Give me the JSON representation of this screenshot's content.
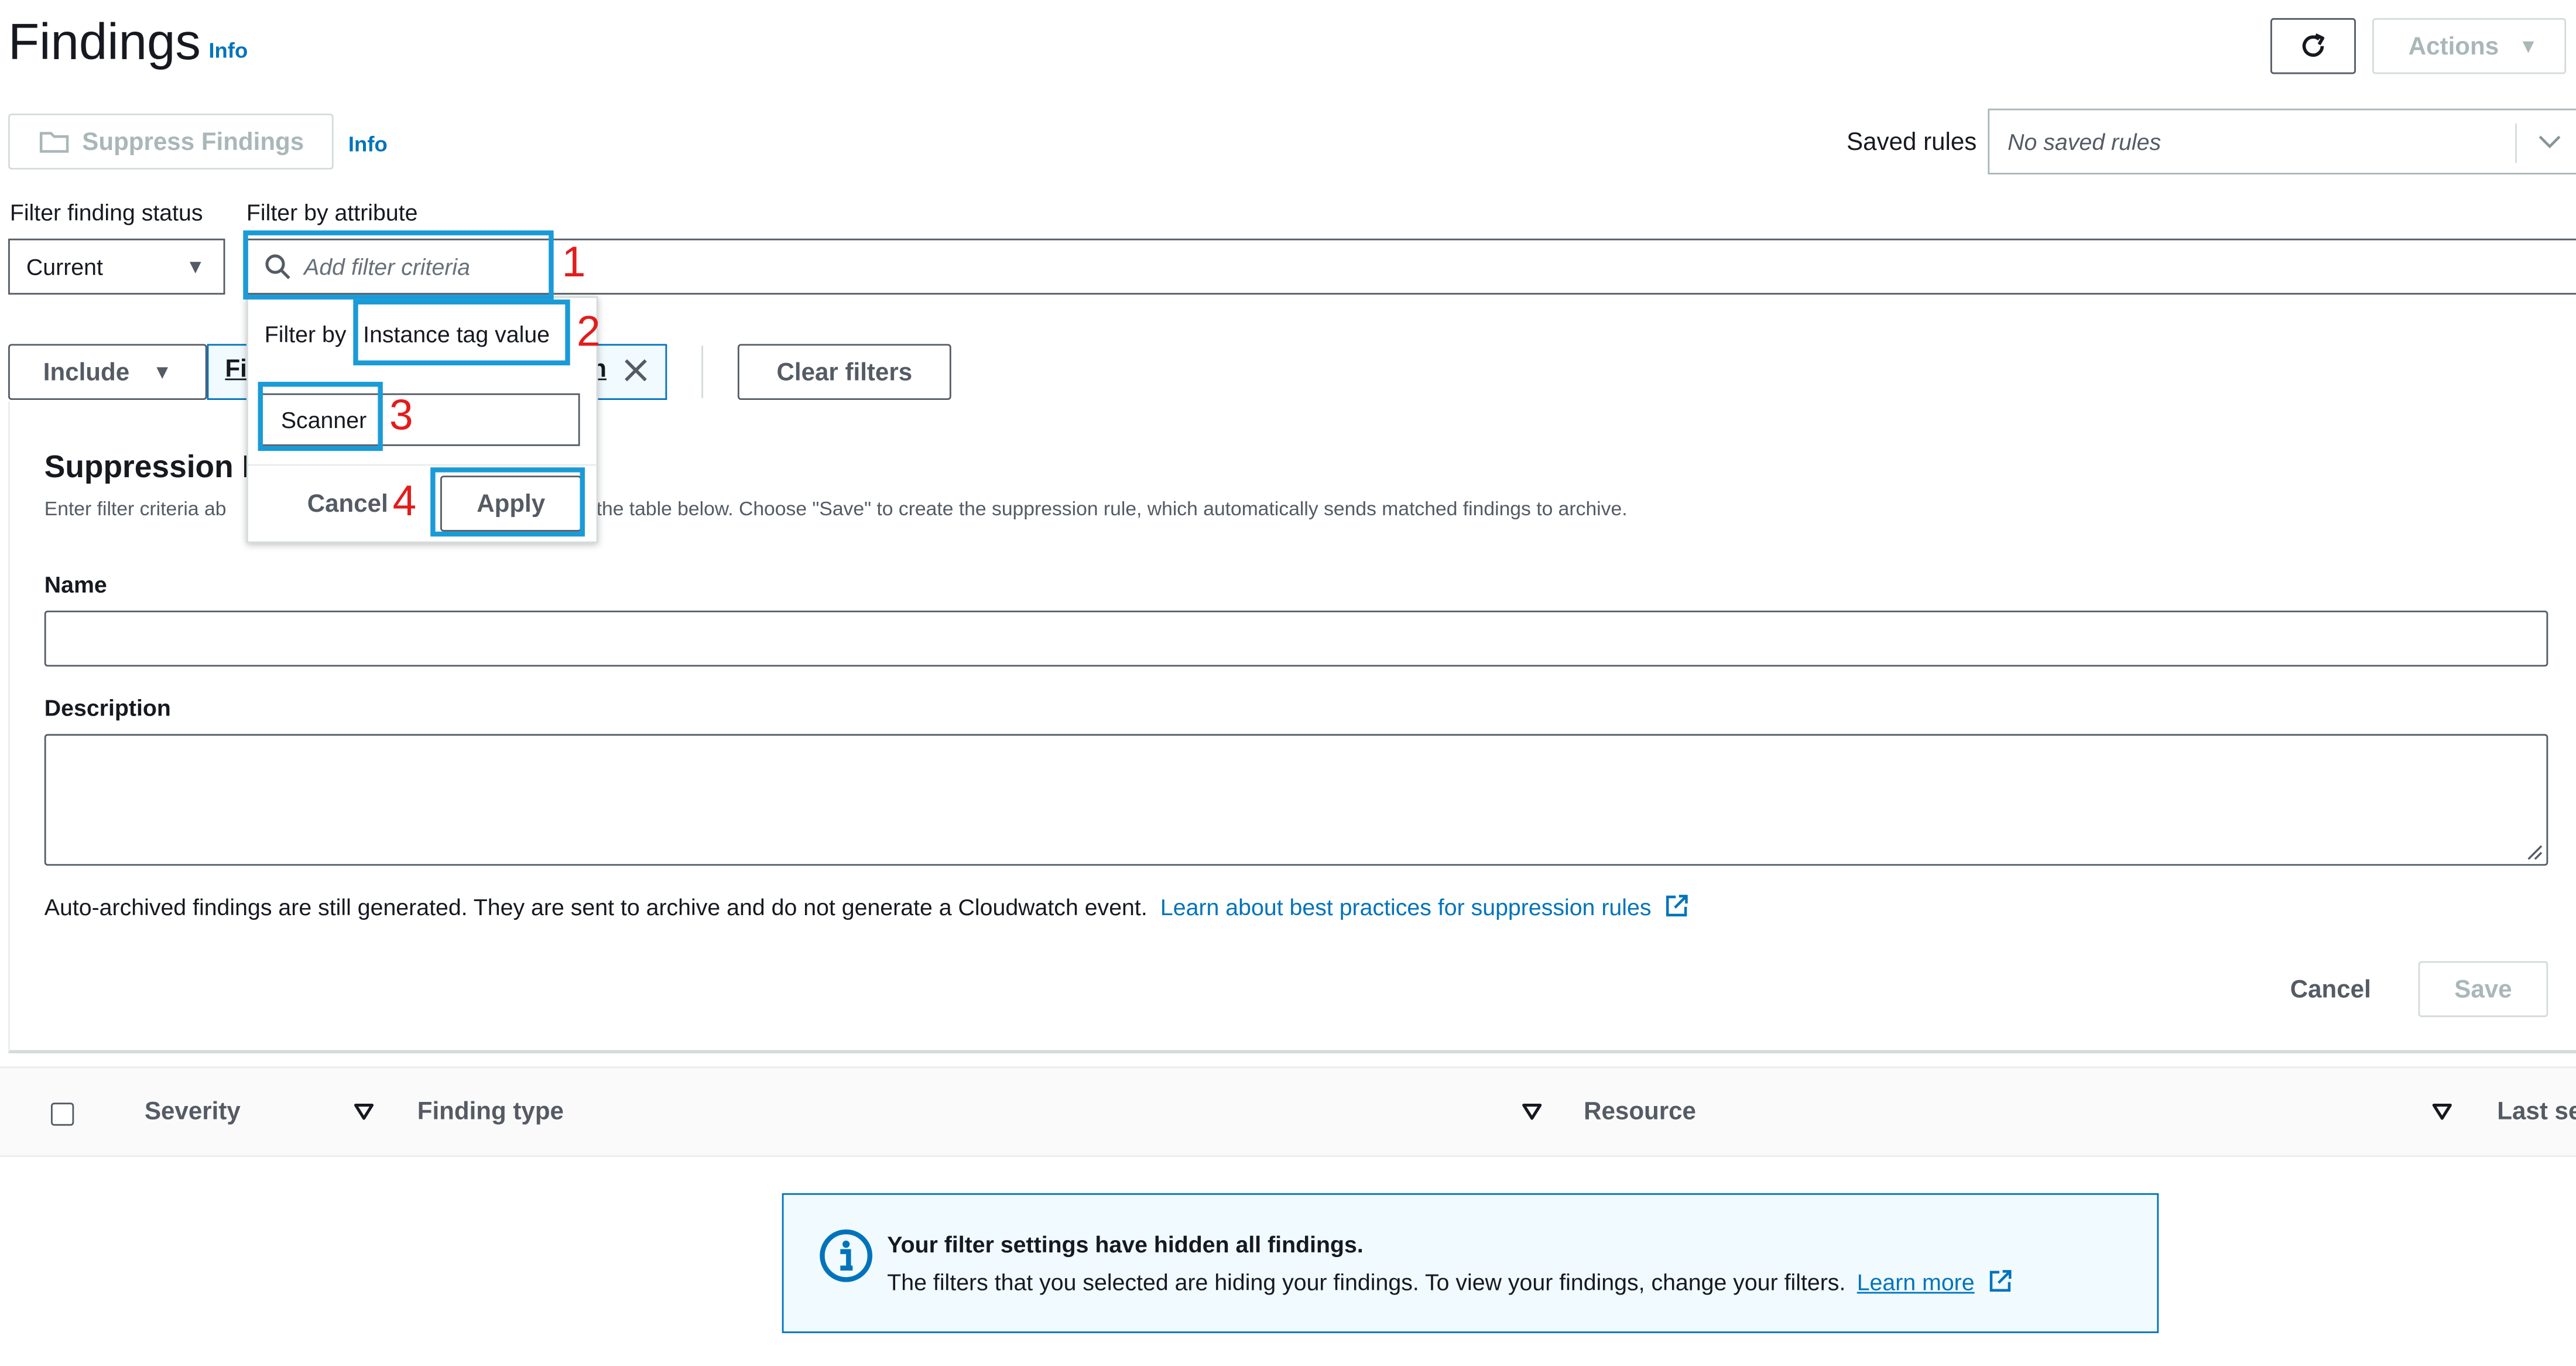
{
  "header": {
    "title": "Findings",
    "info_label": "Info",
    "actions_label": "Actions",
    "refresh_icon": "refresh-icon"
  },
  "toolbar": {
    "suppress_label": "Suppress Findings",
    "info_label": "Info",
    "saved_rules_label": "Saved rules",
    "saved_rules_placeholder": "No saved rules"
  },
  "filters": {
    "status_label": "Filter finding status",
    "attribute_label": "Filter by attribute",
    "status_value": "Current",
    "search_placeholder": "Add filter criteria",
    "include_label": "Include",
    "token_partial_left": "Fi",
    "token_partial_right": "n",
    "clear_filters_label": "Clear filters"
  },
  "popover": {
    "filter_by_prefix": "Filter by",
    "filter_by_value": "Instance tag value",
    "input_value": "Scanner",
    "cancel_label": "Cancel",
    "apply_label": "Apply"
  },
  "callouts": [
    "1",
    "2",
    "3",
    "4"
  ],
  "suppression": {
    "title_partial": "Suppression R",
    "desc_left": "Enter filter criteria ab",
    "desc_right": "the table below. Choose \"Save\" to create the suppression rule, which automatically sends matched findings to archive.",
    "name_label": "Name",
    "name_value": "",
    "description_label": "Description",
    "description_value": "",
    "note": "Auto-archived findings are still generated. They are sent to archive and do not generate a Cloudwatch event.",
    "note_link": "Learn about best practices for suppression rules",
    "cancel_label": "Cancel",
    "save_label": "Save"
  },
  "table": {
    "columns": [
      "Severity",
      "Finding type",
      "Resource",
      "Last se"
    ]
  },
  "alert": {
    "title": "Your filter settings have hidden all findings.",
    "body": "The filters that you selected are hiding your findings. To view your findings, change your filters.",
    "link": "Learn more"
  },
  "colors": {
    "link": "#0073bb",
    "callout_border": "#1a9bd7",
    "callout_number": "#e21c1c",
    "alert_bg": "#f1faff",
    "alert_border": "#0073bb"
  }
}
